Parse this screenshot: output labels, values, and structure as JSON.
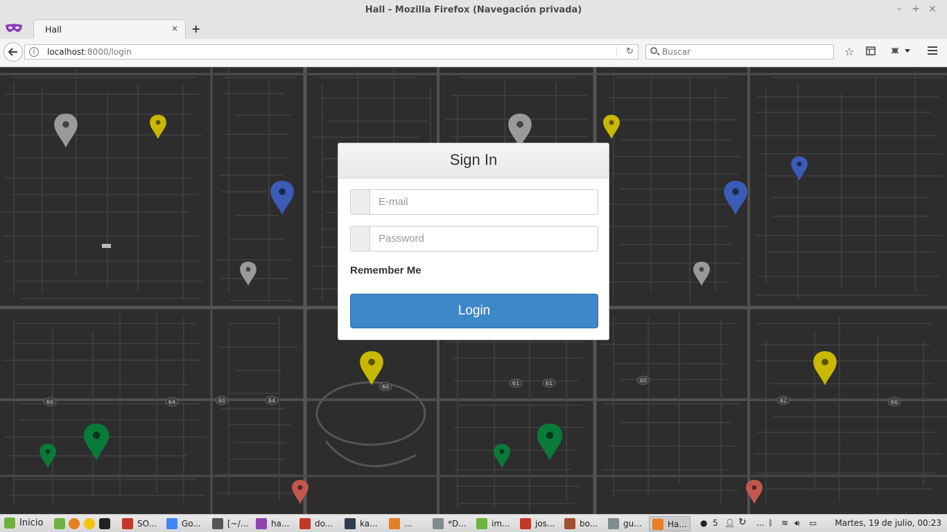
{
  "window": {
    "title": "Hall - Mozilla Firefox (Navegación privada)",
    "controls": [
      "–",
      "+",
      "×"
    ]
  },
  "tab": {
    "label": "Hall",
    "close": "×",
    "new_tab": "+"
  },
  "nav": {
    "url_host": "localhost",
    "url_rest": ":8000/login",
    "search_placeholder": "Buscar",
    "icons": [
      "back-arrow-icon",
      "info-icon",
      "reload-icon",
      "bookmark-star-icon",
      "reading-list-icon",
      "extension-icon",
      "menu-icon"
    ]
  },
  "map": {
    "markers": [
      {
        "color": "#9a9a9a"
      },
      {
        "color": "#c8b800"
      },
      {
        "color": "#9a9a9a"
      },
      {
        "color": "#c8b800"
      },
      {
        "color": "#3b5bb5"
      },
      {
        "color": "#3b5bb5"
      },
      {
        "color": "#3b5bb5"
      },
      {
        "color": "#9a9a9a"
      },
      {
        "color": "#9a9a9a"
      },
      {
        "color": "#c8b800"
      },
      {
        "color": "#c8b800"
      },
      {
        "color": "#0a7a3a"
      },
      {
        "color": "#0a7a3a"
      },
      {
        "color": "#0a7a3a"
      },
      {
        "color": "#0a7a3a"
      },
      {
        "color": "#c0584d"
      },
      {
        "color": "#c0584d"
      }
    ],
    "road_labels": [
      "60",
      "64",
      "60",
      "64",
      "60",
      "61",
      "61",
      "60",
      "62",
      "60"
    ]
  },
  "signin": {
    "title": "Sign In",
    "email_placeholder": "E-mail",
    "password_placeholder": "Password",
    "remember_label": "Remember Me",
    "login_label": "Login"
  },
  "taskbar": {
    "start_label": "Inicio",
    "tasks": [
      {
        "label": "SO...",
        "color": "#c0392b"
      },
      {
        "label": "Go...",
        "color": "#4285f4"
      },
      {
        "label": "[~/...",
        "color": "#555555"
      },
      {
        "label": "ha...",
        "color": "#8e44ad"
      },
      {
        "label": "do...",
        "color": "#c0392b"
      },
      {
        "label": "ka...",
        "color": "#2c3e50"
      },
      {
        "label": "...",
        "color": "#e67e22"
      },
      {
        "label": "*D...",
        "color": "#7f8c8d"
      },
      {
        "label": "im...",
        "color": "#6fb23f"
      },
      {
        "label": "jos...",
        "color": "#c0392b"
      },
      {
        "label": "bo...",
        "color": "#a0522d"
      },
      {
        "label": "gu...",
        "color": "#7f8c8d"
      },
      {
        "label": "Ha...",
        "color": "#e67e22"
      }
    ],
    "tray_count": "5",
    "tray_more": "...",
    "clock": "Martes, 19 de julio, 00:23"
  }
}
